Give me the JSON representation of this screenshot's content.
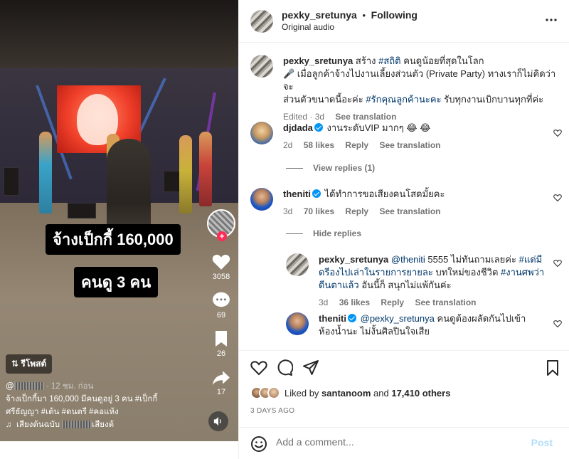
{
  "video": {
    "caption_line1": "จ้างเป็กกี้ 160,000",
    "caption_line2": "คนดู 3 คน",
    "likes": "3058",
    "comments": "69",
    "saves": "26",
    "shares": "17",
    "repost_label": "รีโพสต์",
    "time_ago": "· 12 ชม. ก่อน",
    "description_line1": "จ้างเป็กกี้มา 160,000 มีคนดูอยู่ 3 คน #เป็กกี้",
    "description_line2": "ศรีธัญญา #เต้น #ดนตรี #คอแห้ง",
    "sound_prefix": "เสียงต้นฉบับ",
    "sound_suffix": "เสียงต้"
  },
  "header": {
    "username": "pexky_sretunya",
    "separator": "•",
    "follow_status": "Following",
    "audio": "Original audio",
    "more_icon": "more-horizontal-icon"
  },
  "caption": {
    "username": "pexky_sretunya",
    "line1_prefix": "สร้าง",
    "line1_tag": "#สถิติ",
    "line1_rest": "คนดูน้อยที่สุดในโลก",
    "line2": "🎤 เมื่อลูกค้าจ้างไปงานเลี้ยงส่วนตัว (Private Party) ทางเราก็ไม่คิดว่าจะ",
    "line3_prefix": "ส่วนตัวขนาดนี้อะค่ะ",
    "line3_tag": "#รักคุณลูกค้านะคะ",
    "line3_rest": "รับทุกงานเบิกบานทุกที่ค่ะ",
    "edited": "Edited · 3d",
    "see_translation": "See translation"
  },
  "comments": [
    {
      "username": "djdada",
      "text": "งานระดับVIP มากๆ 😂 😂",
      "age": "2d",
      "likes": "58 likes",
      "reply": "Reply",
      "translate": "See translation",
      "replies_toggle": "View replies (1)"
    },
    {
      "username": "theniti",
      "text": "ได้ทำการขอเสียงคนโสดมั้ยคะ",
      "age": "3d",
      "likes": "70 likes",
      "reply": "Reply",
      "translate": "See translation",
      "replies_toggle": "Hide replies"
    }
  ],
  "replies": [
    {
      "username": "pexky_sretunya",
      "mention": "@theniti",
      "text_a": "5555 ไม่ทันถามเลยค่ะ",
      "tag_a": "#แด่มี",
      "line2_tag": "ดรีองไปเล่าในรายการยายละ",
      "line2_rest": "บทใหม่ของชีวิต",
      "tag_b": "#งานศพว่า",
      "line3_tag": "ดีนตาแล้ว",
      "line3_rest": "อันนี้ก็ สนุกไม่แพ้กันค่ะ",
      "age": "3d",
      "likes": "36 likes",
      "reply": "Reply",
      "translate": "See translation"
    },
    {
      "username": "theniti",
      "mention": "@pexky_sretunya",
      "text_a": "คนดูต้องผลัดกันไปเข้า",
      "line2": "ห้องน้ำนะ ไม่งั้นศิลปินใจเสีย"
    }
  ],
  "actions": {
    "liked_by_prefix": "Liked by",
    "liked_by_user": "santanoom",
    "liked_by_and": "and",
    "liked_by_others": "17,410 others",
    "date": "3 DAYS AGO"
  },
  "comment_box": {
    "placeholder": "Add a comment...",
    "post_label": "Post"
  },
  "colors": {
    "accent_blue": "#0095f6",
    "link_blue": "#00376b",
    "muted": "#737373",
    "post_disabled": "#b2dffc",
    "tiktok_red": "#fe2c55"
  }
}
